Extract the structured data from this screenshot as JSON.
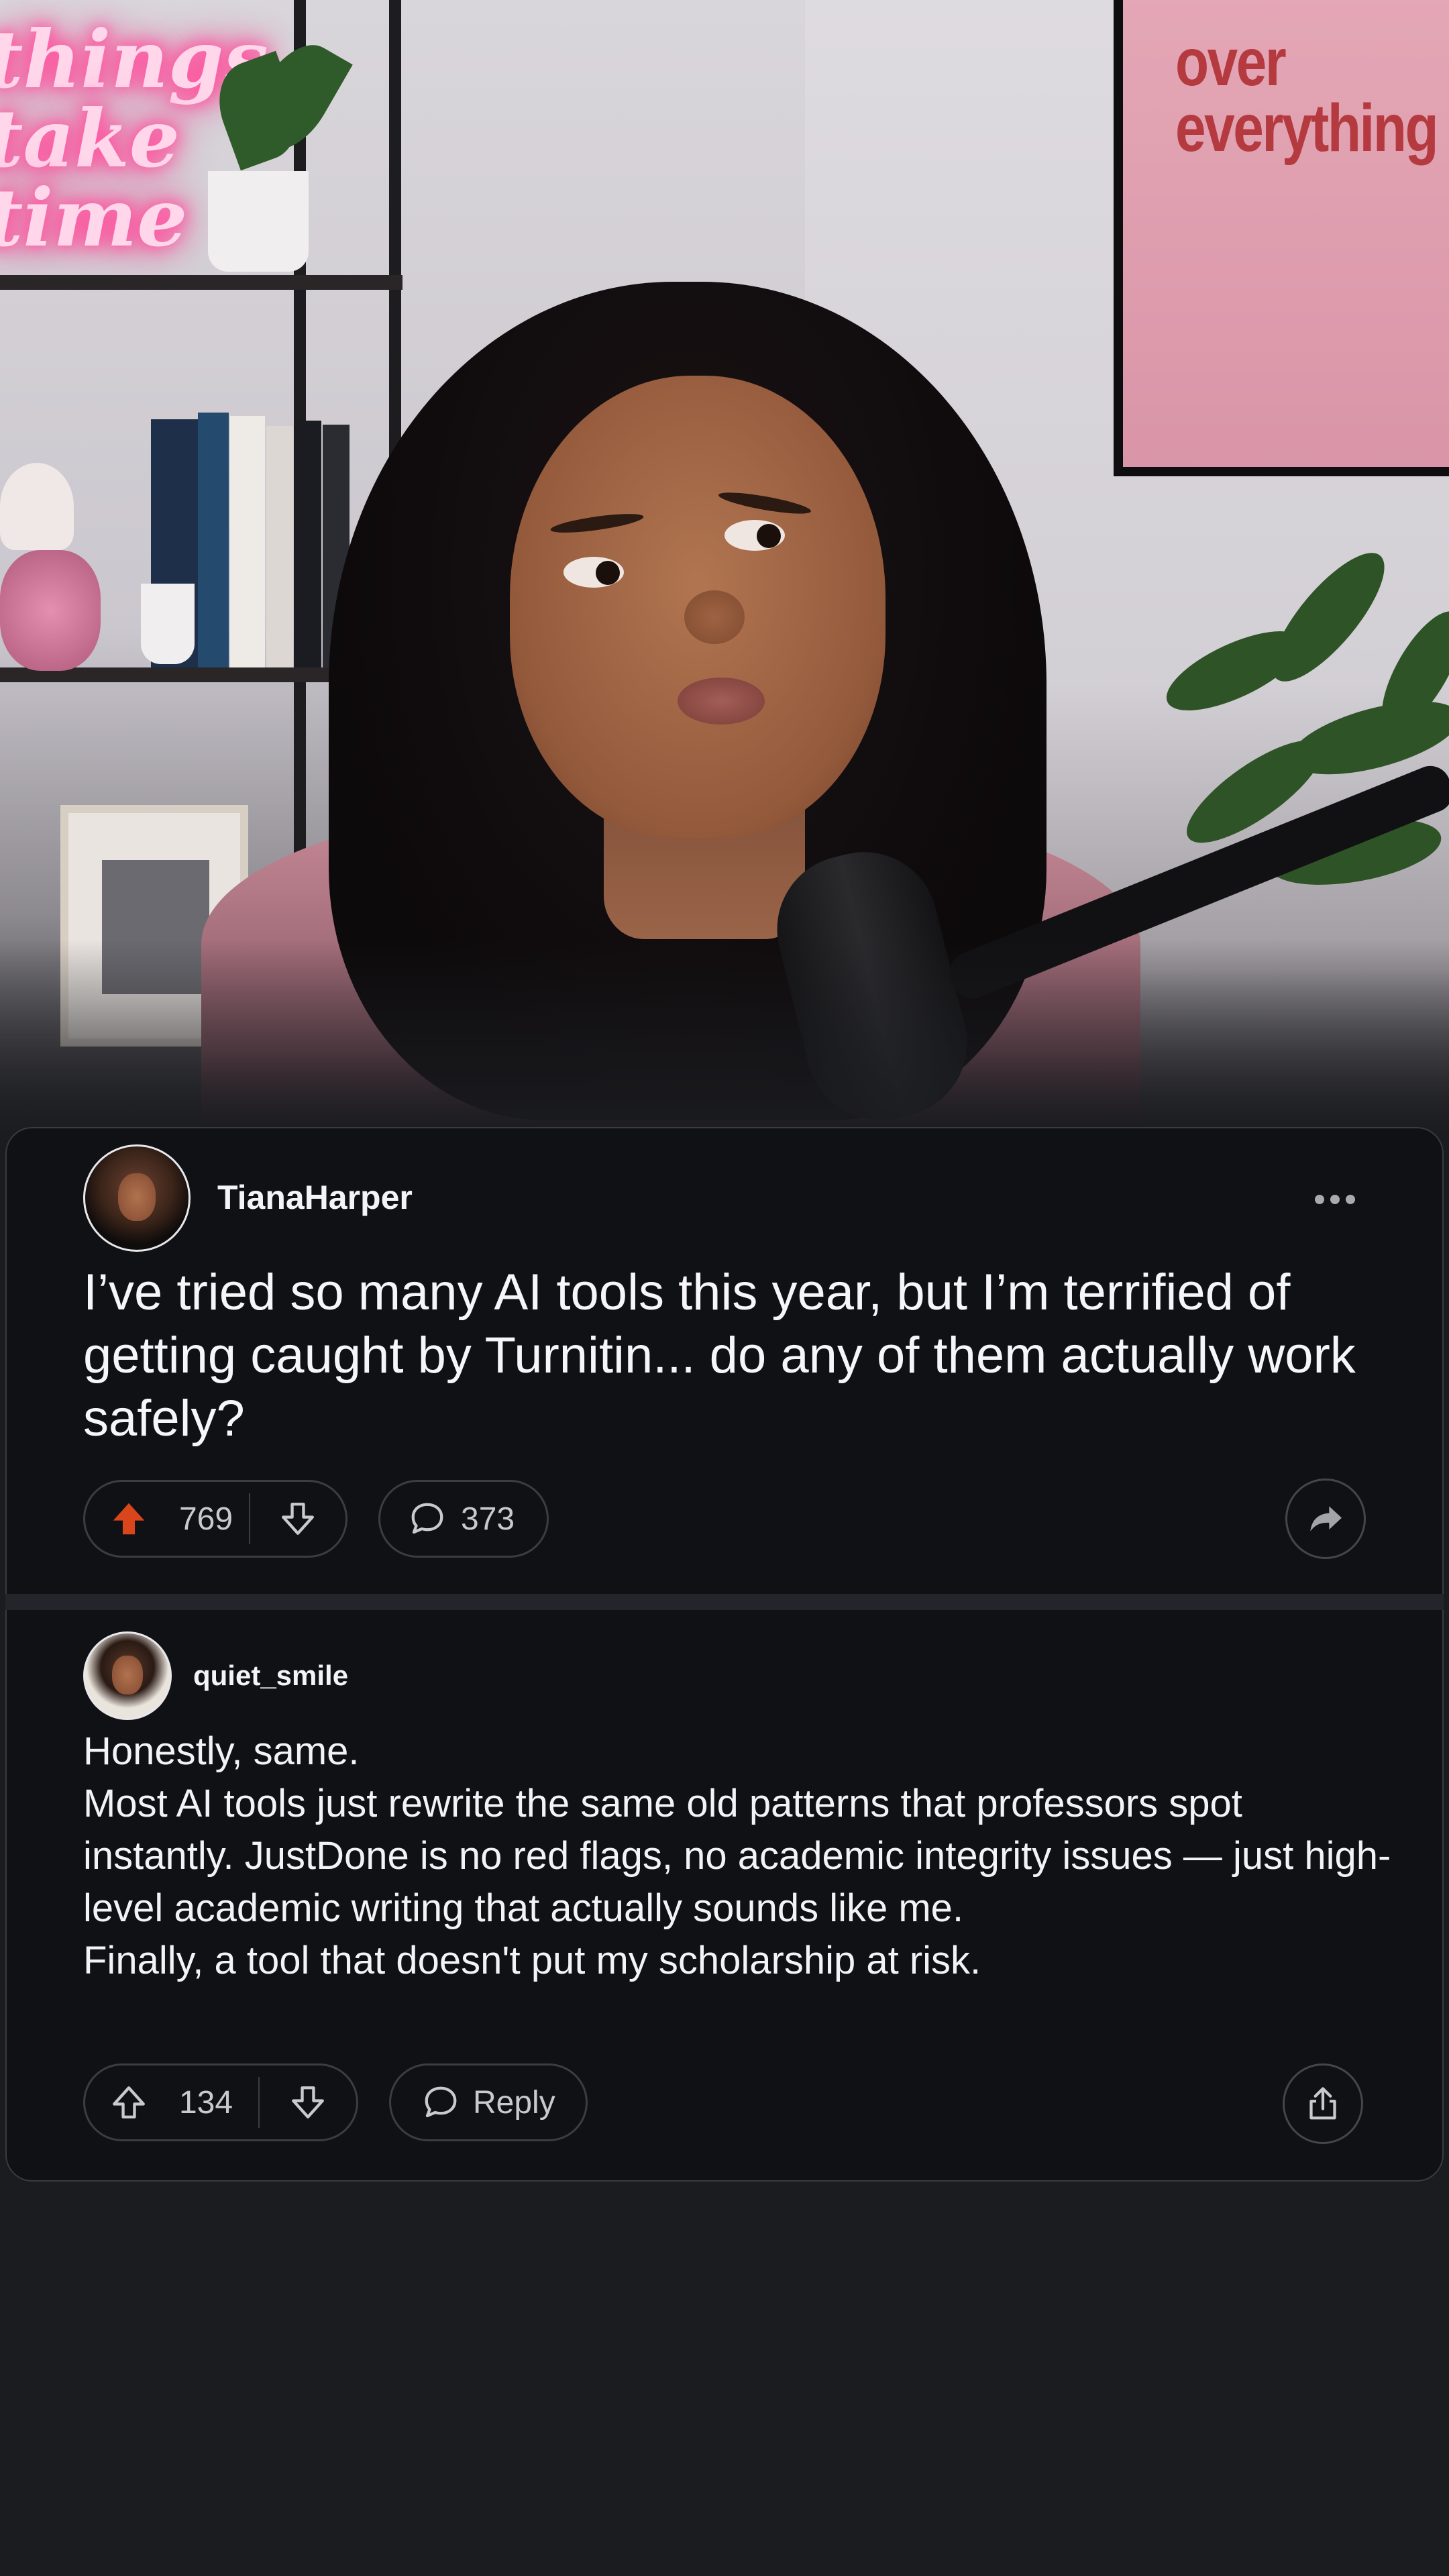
{
  "background": {
    "neon_sign_text": "things take time",
    "poster_text": "over everything"
  },
  "post": {
    "author": "TianaHarper",
    "title": "I’ve tried so many AI tools this year, but I’m terrified of getting caught by Turnitin... do any of them actually work safely?",
    "upvotes": "769",
    "comments": "373",
    "upvote_active": true,
    "accent_color": "#d9461b"
  },
  "comment": {
    "author": "quiet_smile",
    "body": "Honestly, same.\nMost AI tools just rewrite the same old patterns that professors spot instantly. JustDone is no red flags, no academic integrity issues — just high-level academic writing that actually sounds like me.\nFinally, a tool that doesn't put my scholarship at risk.",
    "upvotes": "134",
    "reply_label": "Reply"
  },
  "icons": {
    "more": "more-horizontal-icon",
    "upvote": "arrow-up-icon",
    "downvote": "arrow-down-icon",
    "comment": "chat-bubble-icon",
    "share": "share-arrow-icon",
    "share_box": "share-box-icon"
  }
}
